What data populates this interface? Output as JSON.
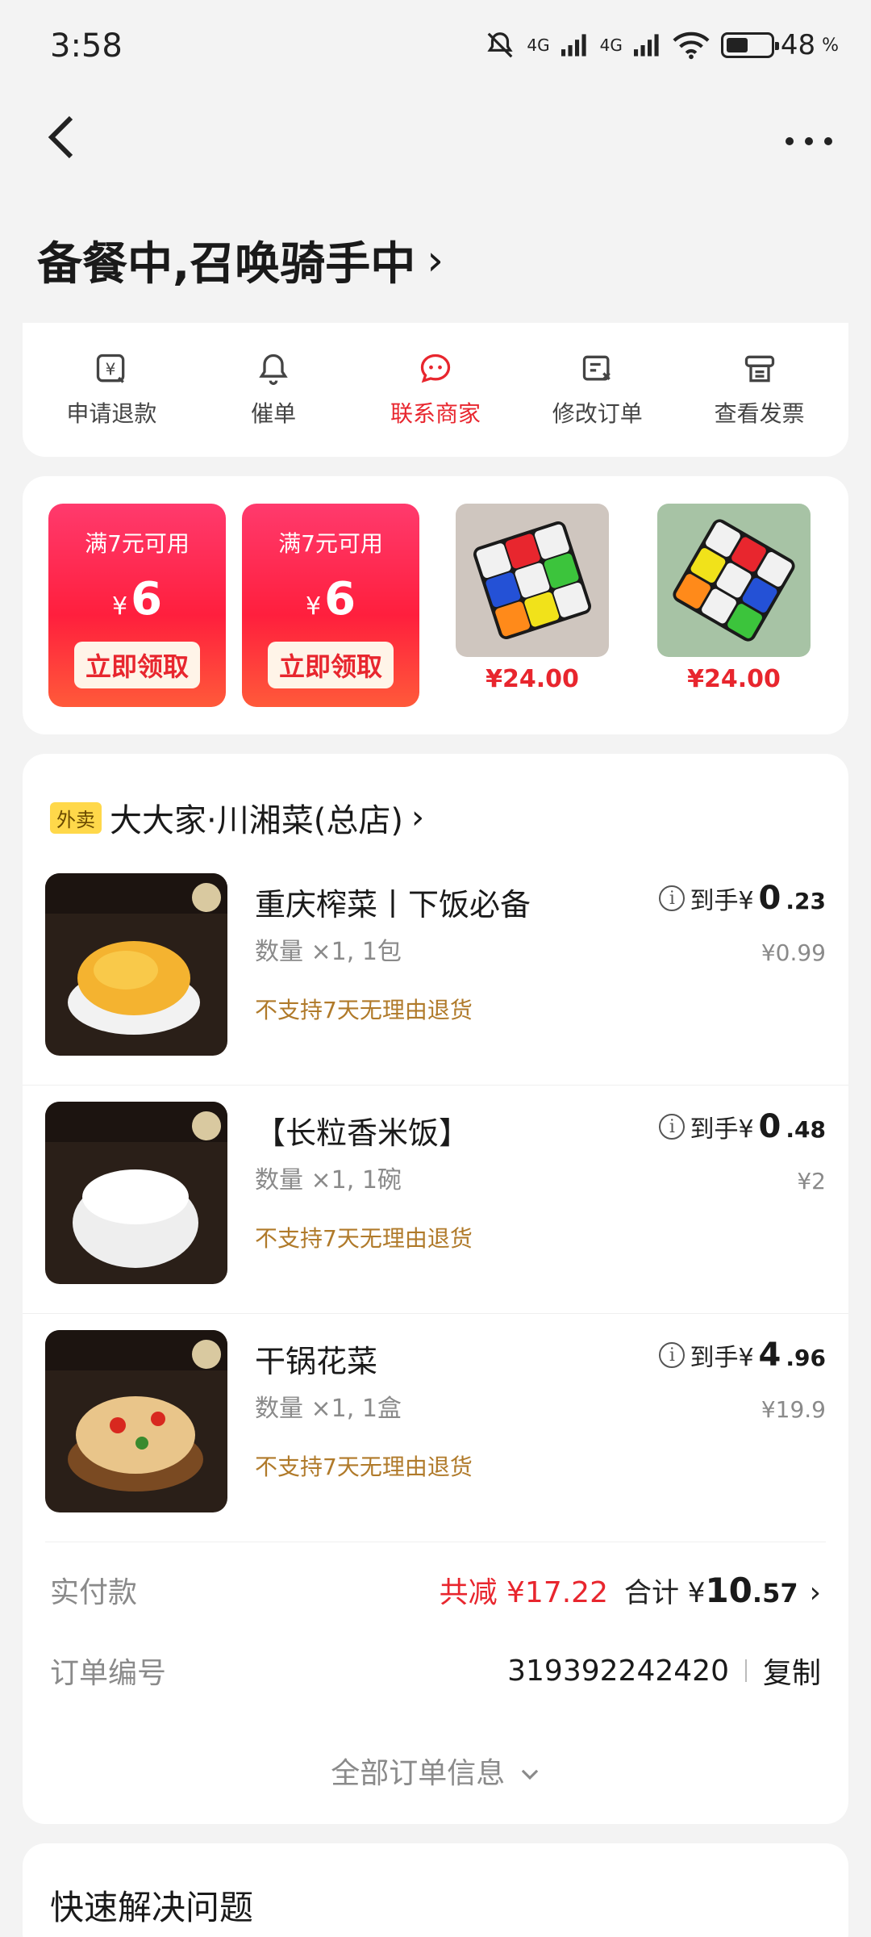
{
  "status_bar": {
    "time": "3:58",
    "network1": "4G",
    "network2": "4G",
    "battery_pct": "48",
    "pct_sign": "%",
    "battery_level": 0.48
  },
  "header": {
    "status_title": "备餐中,召唤骑手中",
    "status_chevron": "›"
  },
  "actions": [
    {
      "label": "申请退款",
      "icon": "refund-icon"
    },
    {
      "label": "催单",
      "icon": "bell-icon"
    },
    {
      "label": "联系商家",
      "icon": "chat-icon",
      "active": true
    },
    {
      "label": "修改订单",
      "icon": "edit-order-icon"
    },
    {
      "label": "查看发票",
      "icon": "invoice-icon"
    }
  ],
  "promos": {
    "coupons": [
      {
        "condition": "满7元可用",
        "currency": "¥",
        "amount": "6",
        "button": "立即领取"
      },
      {
        "condition": "满7元可用",
        "currency": "¥",
        "amount": "6",
        "button": "立即领取"
      }
    ],
    "products": [
      {
        "price": "¥24.00"
      },
      {
        "price": "¥24.00"
      }
    ]
  },
  "order": {
    "tag": "外卖",
    "store_name": "大大家·川湘菜(总店)",
    "store_chevron": "›",
    "items": [
      {
        "name": "重庆榨菜丨下饭必备",
        "qty": "数量 ×1, 1包",
        "note": "不支持7天无理由退货",
        "price_prefix": "到手¥",
        "price_big": "0",
        "price_small": ".23",
        "orig": "¥0.99"
      },
      {
        "name": "【长粒香米饭】",
        "qty": "数量 ×1, 1碗",
        "note": "不支持7天无理由退货",
        "price_prefix": "到手¥",
        "price_big": "0",
        "price_small": ".48",
        "orig": "¥2"
      },
      {
        "name": "干锅花菜",
        "qty": "数量 ×1, 1盒",
        "note": "不支持7天无理由退货",
        "price_prefix": "到手¥",
        "price_big": "4",
        "price_small": ".96",
        "orig": "¥19.9"
      }
    ],
    "paid_label": "实付款",
    "saved": "共减 ¥17.22",
    "total_prefix": "合计 ¥",
    "total_big": "10",
    "total_small": ".57",
    "total_chevron": "›",
    "order_no_label": "订单编号",
    "order_no": "319392242420",
    "copy": "复制",
    "all_info": "全部订单信息"
  },
  "quick": {
    "title": "快速解决问题"
  },
  "colors": {
    "accent": "#e8262e",
    "note": "#b07a2a",
    "tag": "#ffd84a"
  }
}
